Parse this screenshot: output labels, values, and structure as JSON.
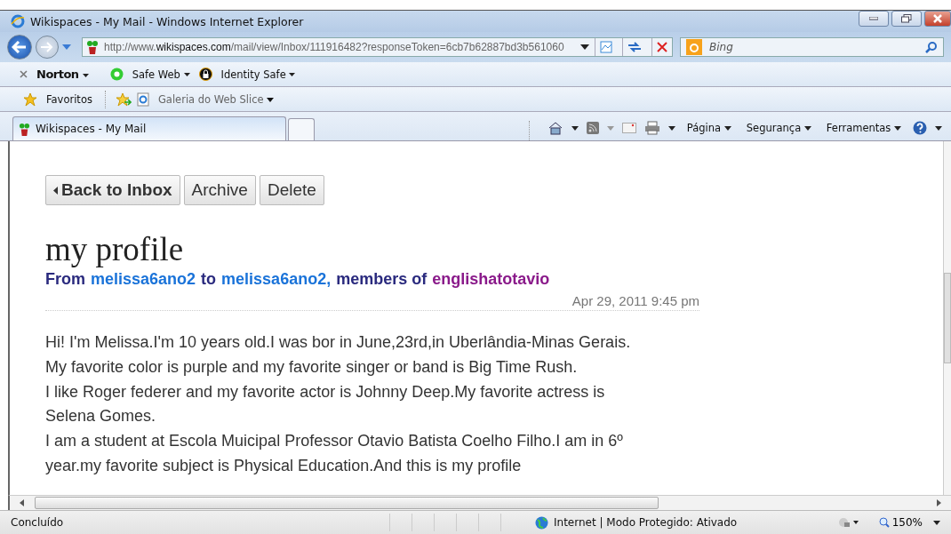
{
  "window": {
    "title": "Wikispaces - My Mail - Windows Internet Explorer"
  },
  "address_bar": {
    "url_prefix": "http://www.",
    "url_domain": "wikispaces.com",
    "url_path": "/mail/view/Inbox/111916482?responseToken=6cb7b62887bd3b561060"
  },
  "search": {
    "placeholder": "Bing"
  },
  "norton_bar": {
    "brand": "Norton",
    "items": [
      "Safe Web",
      "Identity Safe"
    ]
  },
  "favorites_bar": {
    "favorites": "Favoritos",
    "gallery": "Galeria do Web Slice"
  },
  "tabs": [
    {
      "label": "Wikispaces - My Mail",
      "selected": true
    }
  ],
  "command_bar": [
    "Página",
    "Segurança",
    "Ferramentas"
  ],
  "message": {
    "buttons": [
      {
        "label": "Back to Inbox",
        "kind": "back"
      },
      {
        "label": "Archive",
        "kind": "plain"
      },
      {
        "label": "Delete",
        "kind": "plain"
      }
    ],
    "subject": "my profile",
    "from_parts": [
      {
        "text": "From",
        "kind": "plain"
      },
      {
        "text": "melissa6ano2",
        "kind": "user"
      },
      {
        "text": "to",
        "kind": "plain"
      },
      {
        "text": "melissa6ano2,",
        "kind": "user"
      },
      {
        "text": "members of",
        "kind": "plain"
      },
      {
        "text": "englishatotavio",
        "kind": "space"
      }
    ],
    "date": "Apr 29, 2011 9:45 pm",
    "body": [
      "Hi! I'm Melissa.I'm 10 years old.I was bor in June,23rd,in Uberlândia-Minas Gerais.",
      "My favorite color is purple and my favorite singer or band is Big Time Rush.",
      "I like Roger federer and my favorite actor is Johnny Deep.My favorite actress is",
      "Selena Gomes.",
      "I am a student at Escola Muicipal Professor Otavio Batista Coelho Filho.I am in 6º",
      "year.my favorite subject is Physical Education.And this is my profile"
    ]
  },
  "status_bar": {
    "status": "Concluído",
    "zone": "Internet | Modo Protegido: Ativado",
    "zoom": "150%"
  }
}
